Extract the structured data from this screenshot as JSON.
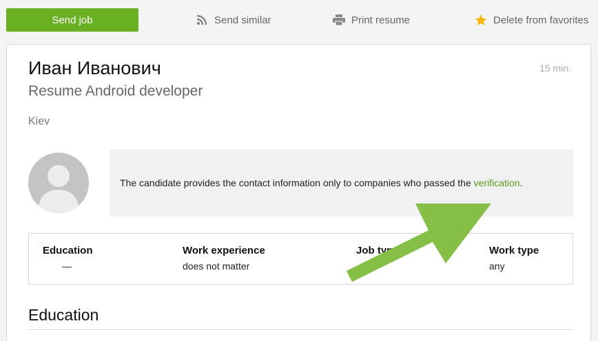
{
  "toolbar": {
    "send_job_label": "Send job",
    "send_similar_label": "Send similar",
    "print_resume_label": "Print resume",
    "delete_favorites_label": "Delete from favorites"
  },
  "resume": {
    "name": "Иван Иванович",
    "time_ago": "15 min.",
    "position": "Resume Android developer",
    "city": "Kiev"
  },
  "notice": {
    "text": "The candidate provides the contact information only to companies who passed the ",
    "link_label": "verification",
    "suffix": "."
  },
  "summary": {
    "columns": [
      {
        "header": "Education",
        "value": "—"
      },
      {
        "header": "Work experience",
        "value": "does not matter"
      },
      {
        "header": "Job type",
        "value": ""
      },
      {
        "header": "Work type",
        "value": "any"
      }
    ]
  },
  "sections": {
    "education_title": "Education"
  },
  "colors": {
    "accent_green": "#6ab023",
    "link_green": "#5a9a1e",
    "arrow_green": "#86bf46",
    "star_yellow": "#f5b400"
  },
  "icons": {
    "send_similar": "rss-icon",
    "print": "printer-icon",
    "favorites": "star-icon",
    "avatar": "user-silhouette-icon",
    "annotation": "arrow-icon"
  }
}
